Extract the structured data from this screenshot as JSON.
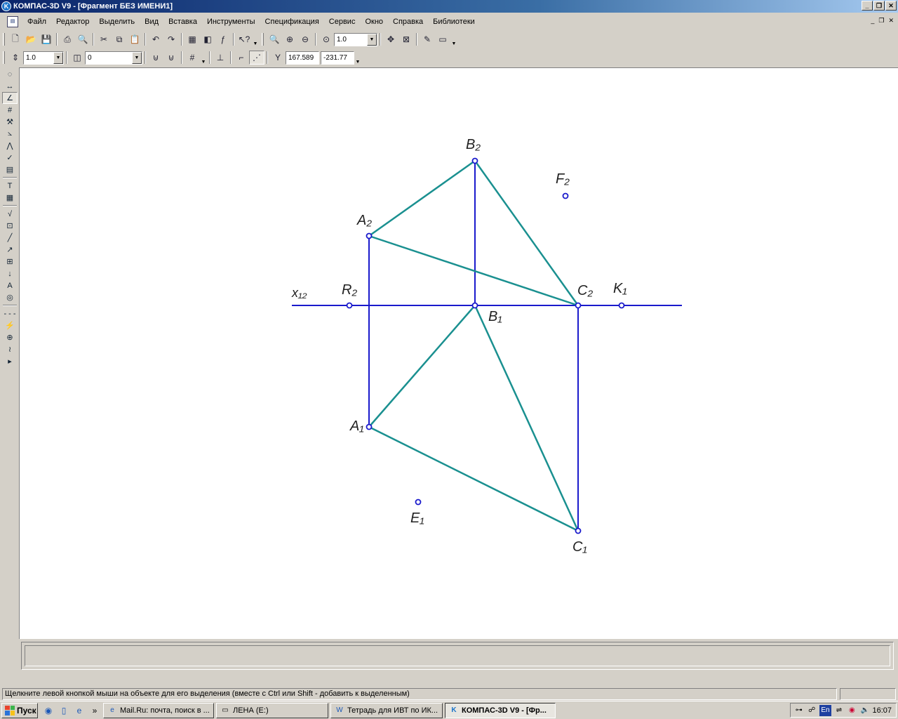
{
  "window": {
    "title": "КОМПАС-3D V9 - [Фрагмент БЕЗ ИМЕНИ1]",
    "icon": "kompas-logo-icon",
    "minimize": "_",
    "restore": "❐",
    "close": "✕"
  },
  "menu": {
    "items": [
      "Файл",
      "Редактор",
      "Выделить",
      "Вид",
      "Вставка",
      "Инструменты",
      "Спецификация",
      "Сервис",
      "Окно",
      "Справка",
      "Библиотеки"
    ],
    "mdi_minimize": "_",
    "mdi_restore": "❐",
    "mdi_close": "✕"
  },
  "toolbar": {
    "zoom_value": "1.0"
  },
  "props_toolbar": {
    "step_value": "1.0",
    "layer_value": "0",
    "coord_label": "Y",
    "coord_x": "167.589",
    "coord_y": "-231.77"
  },
  "drawing": {
    "labels": {
      "x12": "x₁₂",
      "R2": "R₂",
      "A2": "A₂",
      "B2": "B₂",
      "F2": "F₂",
      "C2": "C₂",
      "K1": "K₁",
      "B1": "B₁",
      "A1": "A₁",
      "E1": "E₁",
      "C1": "C₁"
    },
    "colors": {
      "axis": "#1a1acc",
      "triangle": "#1a9090",
      "point": "#1a1acc"
    }
  },
  "status": {
    "message": "Щелкните левой кнопкой мыши на объекте для его выделения (вместе с Ctrl или Shift - добавить к выделенным)"
  },
  "taskbar": {
    "start_label": "Пуск",
    "tasks": [
      {
        "label": "Mail.Ru: почта, поиск в ...",
        "icon": "ie-icon"
      },
      {
        "label": "ЛЕНА (E:)",
        "icon": "drive-icon"
      },
      {
        "label": "Тетрадь для ИВТ по ИК...",
        "icon": "word-icon"
      },
      {
        "label": "КОМПАС-3D V9 - [Фр...",
        "icon": "kompas-icon"
      }
    ],
    "lang": "En",
    "time": "16:07"
  }
}
